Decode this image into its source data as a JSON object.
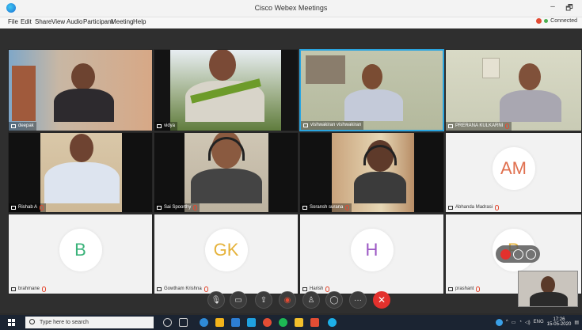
{
  "window": {
    "title": "Cisco Webex Meetings",
    "minimize": "–",
    "restore": "🗗"
  },
  "menu": [
    "File",
    "Edit",
    "Share",
    "View",
    "Audio",
    "Participant",
    "Meeting",
    "Help"
  ],
  "status": {
    "connection": "Connected"
  },
  "participants": [
    {
      "name": "deepak",
      "type": "video"
    },
    {
      "name": "vidya",
      "type": "video"
    },
    {
      "name": "vishwakiran vishwakiran",
      "type": "video",
      "active": true
    },
    {
      "name": "PRERANA KULKARNI",
      "type": "video"
    },
    {
      "name": "Rishab A",
      "type": "video"
    },
    {
      "name": "Sai Spoorthy",
      "type": "video"
    },
    {
      "name": "Soransh surana",
      "type": "video"
    },
    {
      "name": "Abhanda Madrasi",
      "type": "initials",
      "initials": "AM",
      "color": "#e0704f"
    },
    {
      "name": "brahmane",
      "type": "initials",
      "initials": "B",
      "color": "#3bb37a"
    },
    {
      "name": "Gowtham Krishna",
      "type": "initials",
      "initials": "GK",
      "color": "#e5b23a"
    },
    {
      "name": "Harish",
      "type": "initials",
      "initials": "H",
      "color": "#9c58c4"
    },
    {
      "name": "prashant",
      "type": "initials",
      "initials": "P",
      "color": "#e5b23a"
    }
  ],
  "controls": [
    {
      "name": "mute-button",
      "icon": "microphone-icon"
    },
    {
      "name": "video-button",
      "icon": "camera-icon"
    },
    {
      "name": "share-button",
      "icon": "share-icon"
    },
    {
      "name": "record-button",
      "icon": "record-icon"
    },
    {
      "name": "participants-button",
      "icon": "person-icon"
    },
    {
      "name": "chat-button",
      "icon": "chat-icon"
    },
    {
      "name": "more-button",
      "icon": "more-icon"
    },
    {
      "name": "leave-button",
      "icon": "close-icon"
    }
  ],
  "taskbar": {
    "search_placeholder": "Type here to search",
    "language": "ENG",
    "time": "17:26",
    "date": "15-05-2020"
  },
  "colors": {
    "accent": "#2aa5e0",
    "leave": "#e3312d",
    "mute": "#e34b33"
  }
}
